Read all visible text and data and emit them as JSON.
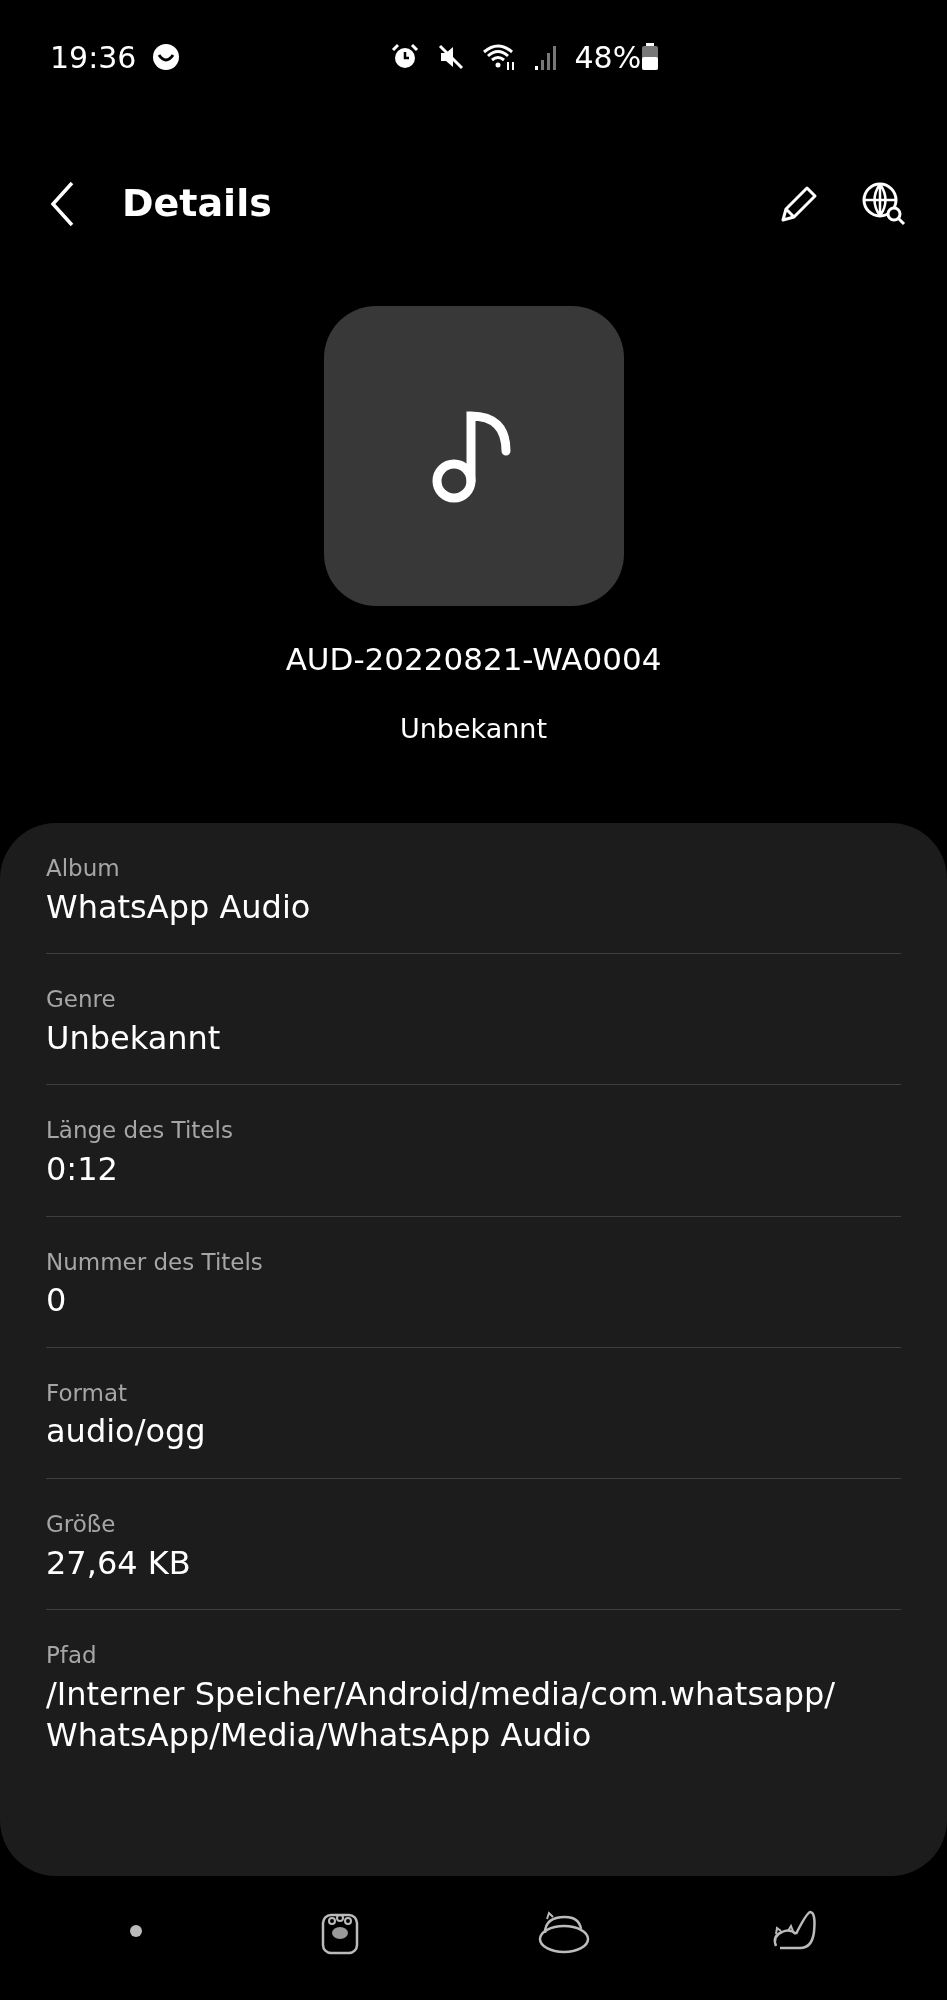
{
  "status_bar": {
    "time": "19:36",
    "battery": "48%"
  },
  "header": {
    "title": "Details"
  },
  "track": {
    "file_name": "AUD-20220821-WA0004",
    "artist": "Unbekannt"
  },
  "details": [
    {
      "label": "Album",
      "value": "WhatsApp Audio"
    },
    {
      "label": "Genre",
      "value": "Unbekannt"
    },
    {
      "label": "Länge des Titels",
      "value": "0:12"
    },
    {
      "label": "Nummer des Titels",
      "value": "0"
    },
    {
      "label": "Format",
      "value": "audio/ogg"
    },
    {
      "label": "Größe",
      "value": "27,64 KB"
    },
    {
      "label": "Pfad",
      "value": "/Interner Speicher/Android/media/com.whatsapp/ WhatsApp/Media/WhatsApp Audio"
    }
  ]
}
